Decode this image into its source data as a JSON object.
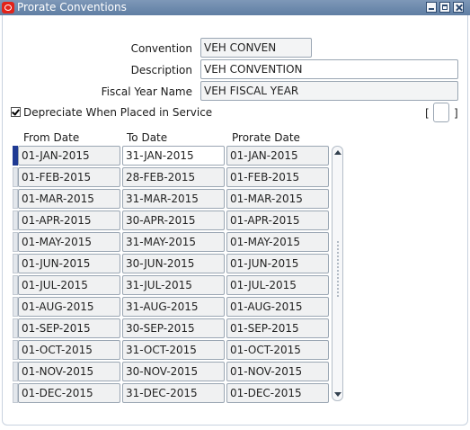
{
  "window": {
    "title": "Prorate Conventions"
  },
  "form": {
    "convention_label": "Convention",
    "convention_value": "VEH CONVEN",
    "description_label": "Description",
    "description_value": "VEH CONVENTION",
    "fiscal_year_label": "Fiscal Year Name",
    "fiscal_year_value": "VEH FISCAL YEAR",
    "depreciate_label": "Depreciate When Placed in Service",
    "depreciate_checked": true,
    "dff_open": "[",
    "dff_close": "]"
  },
  "table": {
    "headers": {
      "from": "From Date",
      "to": "To Date",
      "prorate": "Prorate Date"
    },
    "rows": [
      {
        "from": "01-JAN-2015",
        "to": "31-JAN-2015",
        "prorate": "01-JAN-2015"
      },
      {
        "from": "01-FEB-2015",
        "to": "28-FEB-2015",
        "prorate": "01-FEB-2015"
      },
      {
        "from": "01-MAR-2015",
        "to": "31-MAR-2015",
        "prorate": "01-MAR-2015"
      },
      {
        "from": "01-APR-2015",
        "to": "30-APR-2015",
        "prorate": "01-APR-2015"
      },
      {
        "from": "01-MAY-2015",
        "to": "31-MAY-2015",
        "prorate": "01-MAY-2015"
      },
      {
        "from": "01-JUN-2015",
        "to": "30-JUN-2015",
        "prorate": "01-JUN-2015"
      },
      {
        "from": "01-JUL-2015",
        "to": "31-JUL-2015",
        "prorate": "01-JUL-2015"
      },
      {
        "from": "01-AUG-2015",
        "to": "31-AUG-2015",
        "prorate": "01-AUG-2015"
      },
      {
        "from": "01-SEP-2015",
        "to": "30-SEP-2015",
        "prorate": "01-SEP-2015"
      },
      {
        "from": "01-OCT-2015",
        "to": "31-OCT-2015",
        "prorate": "01-OCT-2015"
      },
      {
        "from": "01-NOV-2015",
        "to": "30-NOV-2015",
        "prorate": "01-NOV-2015"
      },
      {
        "from": "01-DEC-2015",
        "to": "31-DEC-2015",
        "prorate": "01-DEC-2015"
      }
    ]
  },
  "colors": {
    "titlebar": "#5f7ea3",
    "current_record_indicator": "#1f3a93",
    "app_icon": "#e2231a"
  },
  "icons": {
    "app": "oracle-icon",
    "minimize": "minimize-icon",
    "maximize": "maximize-icon",
    "close": "close-icon",
    "scroll_up": "arrow-up-icon",
    "scroll_down": "arrow-down-icon"
  }
}
